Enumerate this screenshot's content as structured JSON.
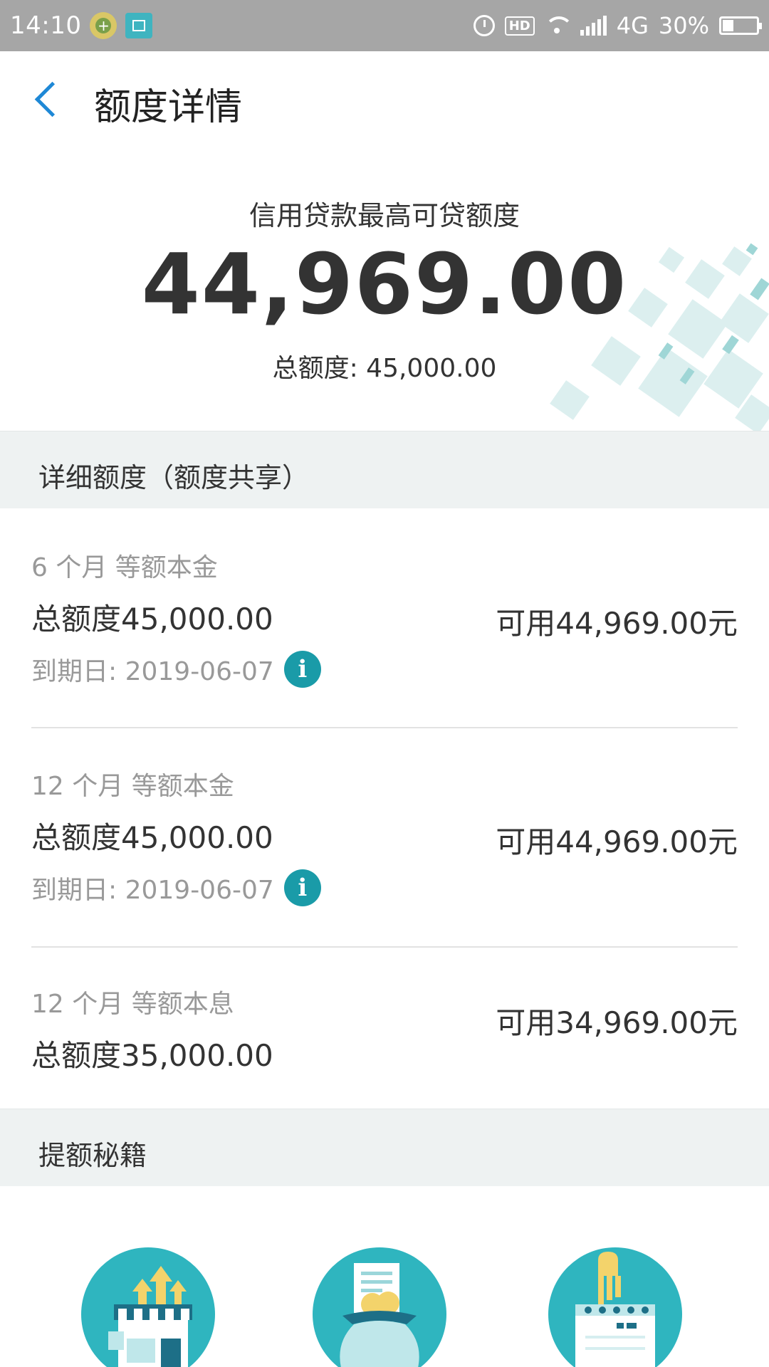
{
  "status_bar": {
    "time": "14:10",
    "network": "4G",
    "battery": "30%",
    "icons": [
      "app-notification-icon",
      "scan-icon",
      "alarm-icon",
      "hd-icon",
      "wifi-icon",
      "signal-icon",
      "battery-icon"
    ]
  },
  "header": {
    "title": "额度详情"
  },
  "hero": {
    "label": "信用贷款最高可贷额度",
    "amount": "44,969.00",
    "total": "总额度: 45,000.00"
  },
  "details_section": {
    "title": "详细额度（额度共享）",
    "items": [
      {
        "term": "6 个月 等额本金",
        "total": "总额度45,000.00",
        "available": "可用44,969.00元",
        "due": "到期日: 2019-06-07"
      },
      {
        "term": "12 个月 等额本金",
        "total": "总额度45,000.00",
        "available": "可用44,969.00元",
        "due": "到期日: 2019-06-07"
      },
      {
        "term": "12 个月 等额本息",
        "total": "总额度35,000.00",
        "available": "可用34,969.00元"
      }
    ]
  },
  "tips_section": {
    "title": "提额秘籍",
    "icons": [
      "store-upgrade-icon",
      "money-bag-icon",
      "calendar-sign-icon"
    ]
  },
  "colors": {
    "accent_blue": "#1e88d6",
    "teal": "#1a9ba8",
    "section_bg": "#eef2f2",
    "status_bar": "#a6a6a6"
  }
}
